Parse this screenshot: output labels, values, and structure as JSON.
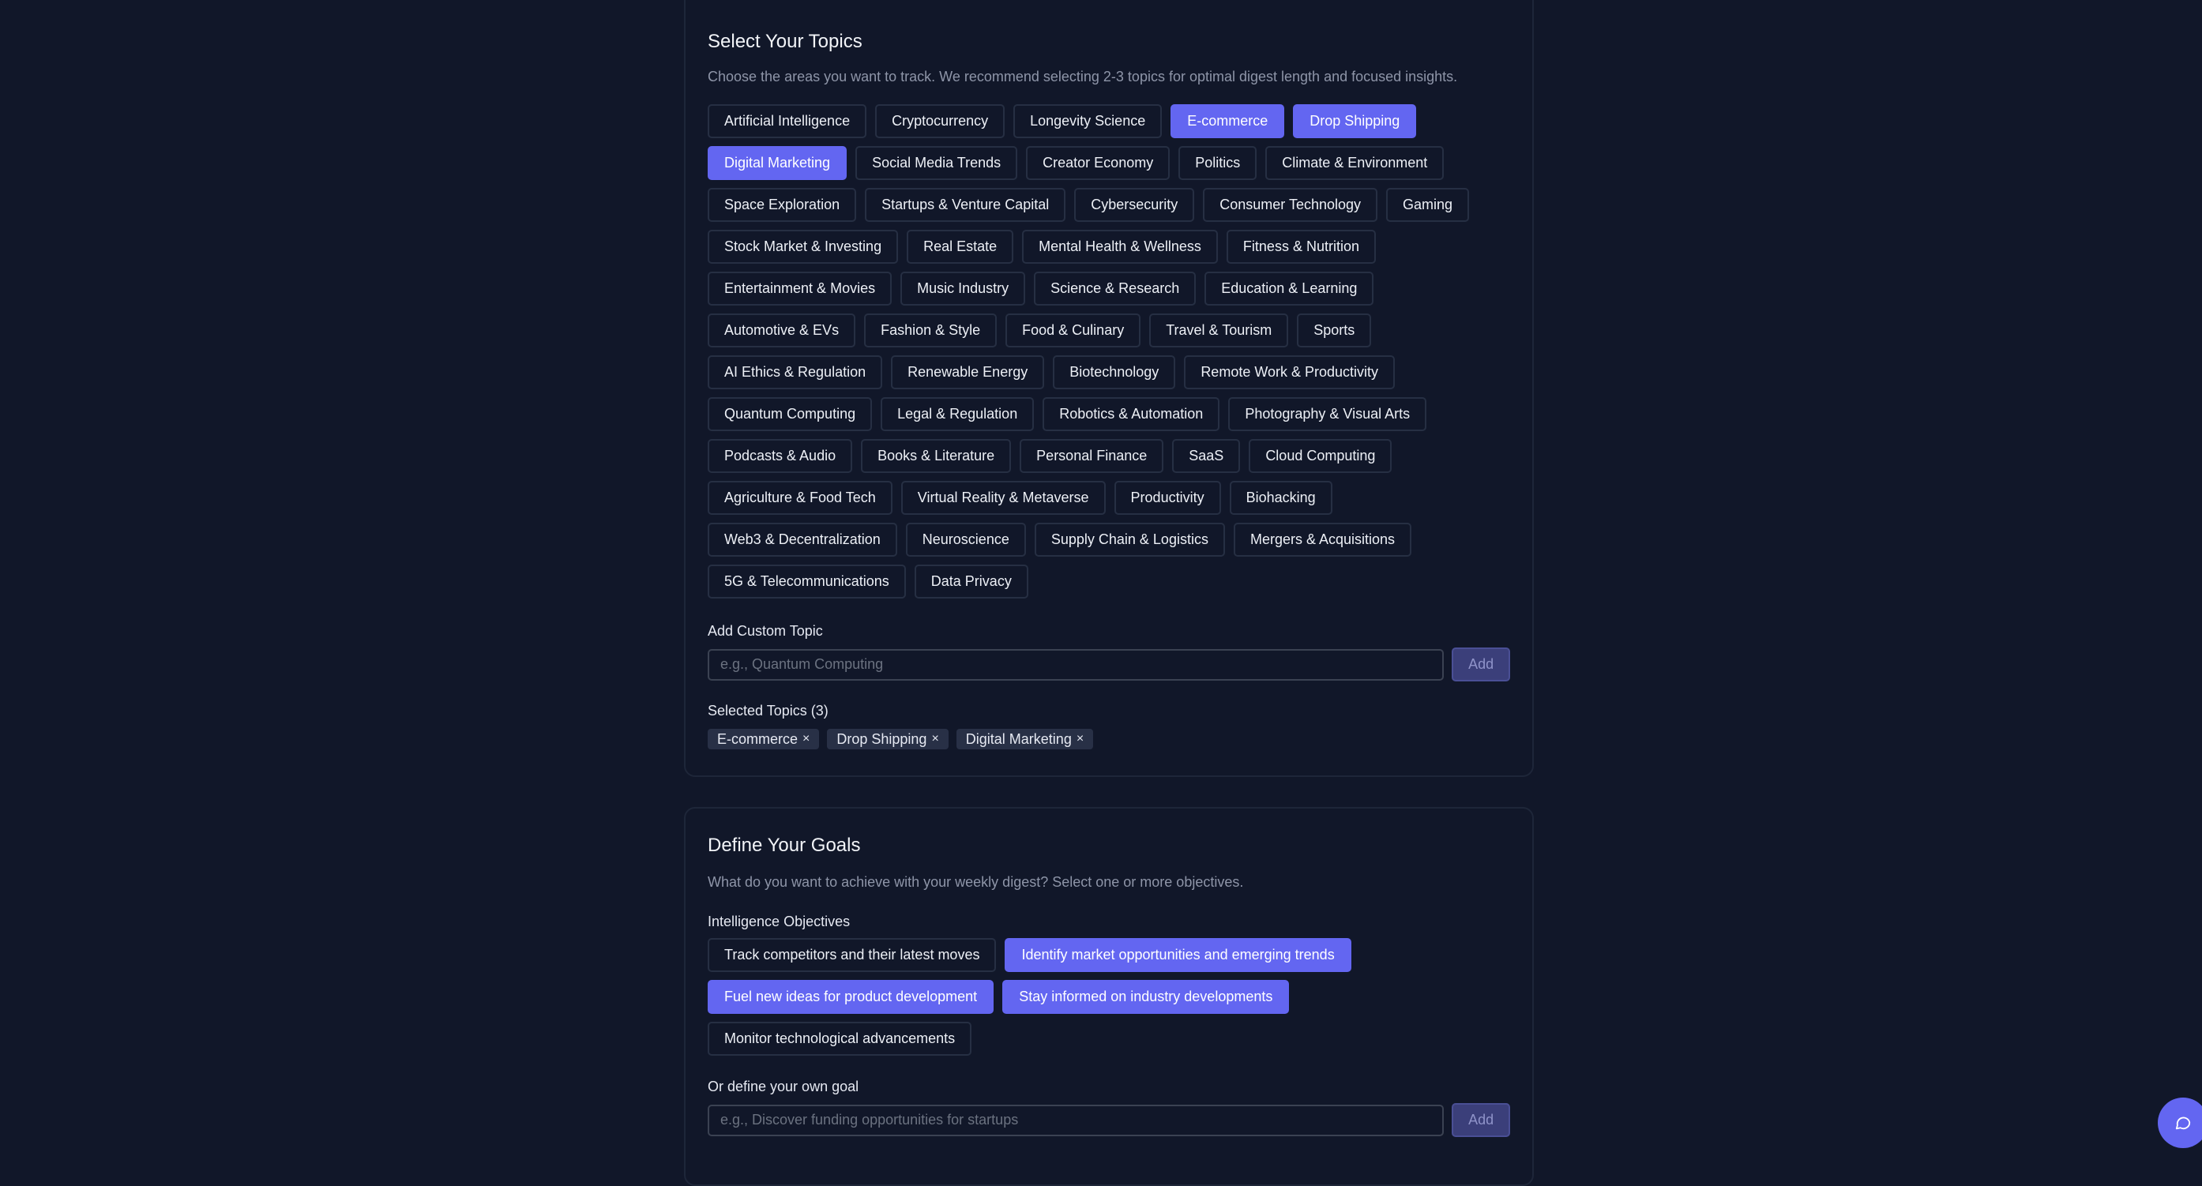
{
  "topics": {
    "title": "Select Your Topics",
    "description": "Choose the areas you want to track. We recommend selecting 2-3 topics for optimal digest length and focused insights.",
    "chips": [
      {
        "label": "Artificial Intelligence",
        "selected": false
      },
      {
        "label": "Cryptocurrency",
        "selected": false
      },
      {
        "label": "Longevity Science",
        "selected": false
      },
      {
        "label": "E-commerce",
        "selected": true
      },
      {
        "label": "Drop Shipping",
        "selected": true
      },
      {
        "label": "Digital Marketing",
        "selected": true
      },
      {
        "label": "Social Media Trends",
        "selected": false
      },
      {
        "label": "Creator Economy",
        "selected": false
      },
      {
        "label": "Politics",
        "selected": false
      },
      {
        "label": "Climate & Environment",
        "selected": false
      },
      {
        "label": "Space Exploration",
        "selected": false
      },
      {
        "label": "Startups & Venture Capital",
        "selected": false
      },
      {
        "label": "Cybersecurity",
        "selected": false
      },
      {
        "label": "Consumer Technology",
        "selected": false
      },
      {
        "label": "Gaming",
        "selected": false
      },
      {
        "label": "Stock Market & Investing",
        "selected": false
      },
      {
        "label": "Real Estate",
        "selected": false
      },
      {
        "label": "Mental Health & Wellness",
        "selected": false
      },
      {
        "label": "Fitness & Nutrition",
        "selected": false
      },
      {
        "label": "Entertainment & Movies",
        "selected": false
      },
      {
        "label": "Music Industry",
        "selected": false
      },
      {
        "label": "Science & Research",
        "selected": false
      },
      {
        "label": "Education & Learning",
        "selected": false
      },
      {
        "label": "Automotive & EVs",
        "selected": false
      },
      {
        "label": "Fashion & Style",
        "selected": false
      },
      {
        "label": "Food & Culinary",
        "selected": false
      },
      {
        "label": "Travel & Tourism",
        "selected": false
      },
      {
        "label": "Sports",
        "selected": false
      },
      {
        "label": "AI Ethics & Regulation",
        "selected": false
      },
      {
        "label": "Renewable Energy",
        "selected": false
      },
      {
        "label": "Biotechnology",
        "selected": false
      },
      {
        "label": "Remote Work & Productivity",
        "selected": false
      },
      {
        "label": "Quantum Computing",
        "selected": false
      },
      {
        "label": "Legal & Regulation",
        "selected": false
      },
      {
        "label": "Robotics & Automation",
        "selected": false
      },
      {
        "label": "Photography & Visual Arts",
        "selected": false
      },
      {
        "label": "Podcasts & Audio",
        "selected": false
      },
      {
        "label": "Books & Literature",
        "selected": false
      },
      {
        "label": "Personal Finance",
        "selected": false
      },
      {
        "label": "SaaS",
        "selected": false
      },
      {
        "label": "Cloud Computing",
        "selected": false
      },
      {
        "label": "Agriculture & Food Tech",
        "selected": false
      },
      {
        "label": "Virtual Reality & Metaverse",
        "selected": false
      },
      {
        "label": "Productivity",
        "selected": false
      },
      {
        "label": "Biohacking",
        "selected": false
      },
      {
        "label": "Web3 & Decentralization",
        "selected": false
      },
      {
        "label": "Neuroscience",
        "selected": false
      },
      {
        "label": "Supply Chain & Logistics",
        "selected": false
      },
      {
        "label": "Mergers & Acquisitions",
        "selected": false
      },
      {
        "label": "5G & Telecommunications",
        "selected": false
      },
      {
        "label": "Data Privacy",
        "selected": false
      }
    ],
    "custom_label": "Add Custom Topic",
    "custom_placeholder": "e.g., Quantum Computing",
    "add_label": "Add",
    "selected_label": "Selected Topics (3)",
    "selected": [
      "E-commerce",
      "Drop Shipping",
      "Digital Marketing"
    ],
    "remove_glyph": "×"
  },
  "goals": {
    "title": "Define Your Goals",
    "description": "What do you want to achieve with your weekly digest? Select one or more objectives.",
    "objectives_label": "Intelligence Objectives",
    "chips": [
      {
        "label": "Track competitors and their latest moves",
        "selected": false
      },
      {
        "label": "Identify market opportunities and emerging trends",
        "selected": true
      },
      {
        "label": "Fuel new ideas for product development",
        "selected": true
      },
      {
        "label": "Stay informed on industry developments",
        "selected": true
      },
      {
        "label": "Monitor technological advancements",
        "selected": false
      }
    ],
    "custom_label": "Or define your own goal",
    "custom_placeholder": "e.g., Discover funding opportunities for startups",
    "add_label": "Add"
  },
  "colors": {
    "background": "#111729",
    "accent": "#6366f1",
    "chip_border": "#262f43",
    "muted_text": "#8e95a8"
  },
  "icons": {
    "chat_fab": "chat-bubble-icon"
  }
}
